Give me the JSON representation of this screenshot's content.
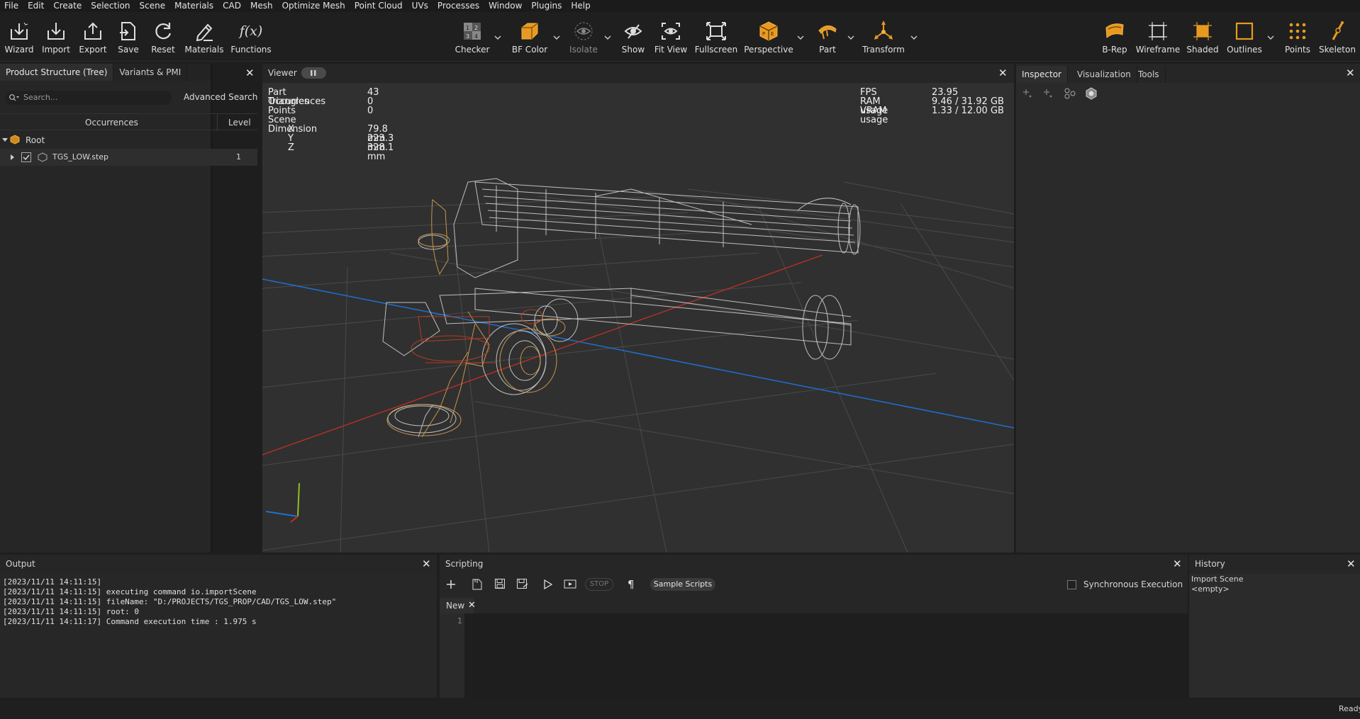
{
  "menu": [
    "File",
    "Edit",
    "Create",
    "Selection",
    "Scene",
    "Materials",
    "CAD",
    "Mesh",
    "Optimize Mesh",
    "Point Cloud",
    "UVs",
    "Processes",
    "Window",
    "Plugins",
    "Help"
  ],
  "toolbar": {
    "left": [
      {
        "label": "Wizard",
        "icon": "wizard-icon"
      },
      {
        "label": "Import",
        "icon": "import-icon"
      },
      {
        "label": "Export",
        "icon": "export-icon"
      },
      {
        "label": "Save",
        "icon": "save-icon"
      },
      {
        "label": "Reset",
        "icon": "reset-icon"
      },
      {
        "label": "Materials",
        "icon": "pencil-icon"
      },
      {
        "label": "Functions",
        "icon": "fx-icon",
        "glyph": "f(x)"
      }
    ],
    "center": [
      {
        "label": "Checker",
        "icon": "checker-icon",
        "glyph": "1 2\n3 4"
      },
      {
        "label": "BF Color",
        "icon": "cube-icon"
      },
      {
        "label": "Isolate",
        "icon": "isolate-eye-icon"
      },
      {
        "label": "Show",
        "icon": "hidden-eye-icon"
      },
      {
        "label": "Fit View",
        "icon": "fit-view-icon"
      },
      {
        "label": "Fullscreen",
        "icon": "fullscreen-icon"
      },
      {
        "label": "Perspective",
        "icon": "perspective-cube-icon",
        "glyph": "PE"
      },
      {
        "label": "Part",
        "icon": "part-icon"
      },
      {
        "label": "Transform",
        "icon": "transform-gizmo-icon"
      }
    ],
    "right": [
      {
        "label": "B-Rep",
        "icon": "brep-icon"
      },
      {
        "label": "Wireframe",
        "icon": "wireframe-icon"
      },
      {
        "label": "Shaded",
        "icon": "shaded-icon"
      },
      {
        "label": "Outlines",
        "icon": "outlines-icon"
      },
      {
        "label": "Points",
        "icon": "points-icon"
      },
      {
        "label": "Skeleton",
        "icon": "skeleton-icon"
      }
    ]
  },
  "left_panel": {
    "tabs": [
      "Product Structure (Tree)",
      "Variants & PMI"
    ],
    "search_placeholder": "Search...",
    "advanced_search": "Advanced Search",
    "col_occurrences": "Occurrences",
    "col_level": "Level",
    "tree": [
      {
        "name": "Root",
        "level": ""
      },
      {
        "name": "TGS_LOW.step",
        "level": "1"
      }
    ]
  },
  "viewer": {
    "tab": "Viewer",
    "stats_left": [
      {
        "label": "Part Occurrences",
        "value": "43"
      },
      {
        "label": "Triangles",
        "value": "0"
      },
      {
        "label": "Points",
        "value": "0"
      },
      {
        "label": "Scene Dimension",
        "value": ""
      },
      {
        "label": "X",
        "value": "79.8 mm"
      },
      {
        "label": "Y",
        "value": "223.3 mm"
      },
      {
        "label": "Z",
        "value": "328.1 mm"
      }
    ],
    "stats_right": [
      {
        "label": "FPS",
        "value": "23.95"
      },
      {
        "label": "RAM usage",
        "value": "9.46 / 31.92 GB"
      },
      {
        "label": "VRAM usage",
        "value": "1.33 / 12.00 GB"
      }
    ]
  },
  "right_panel": {
    "tabs": [
      "Inspector",
      "Visualization",
      "Tools"
    ]
  },
  "output": {
    "title": "Output",
    "lines": [
      "[2023/11/11 14:11:15]",
      "[2023/11/11 14:11:15] executing command io.importScene",
      "[2023/11/11 14:11:15] fileName: \"D:/PROJECTS/TGS_PROP/CAD/TGS_LOW.step\"",
      "[2023/11/11 14:11:15] root: 0",
      "[2023/11/11 14:11:17] Command execution time : 1.975 s"
    ]
  },
  "scripting": {
    "title": "Scripting",
    "stop": "STOP",
    "paragraph": "¶",
    "sample_scripts": "Sample Scripts",
    "sync_label": "Synchronous Execution",
    "tab_new": "New",
    "line_no": "1"
  },
  "history": {
    "title": "History",
    "items": [
      "Import Scene",
      "<empty>"
    ]
  },
  "status": "Ready",
  "colors": {
    "accent": "#f0a020",
    "axis_blue": "#1f6fd0",
    "axis_red": "#c03028",
    "axis_green": "#8fbf20"
  }
}
